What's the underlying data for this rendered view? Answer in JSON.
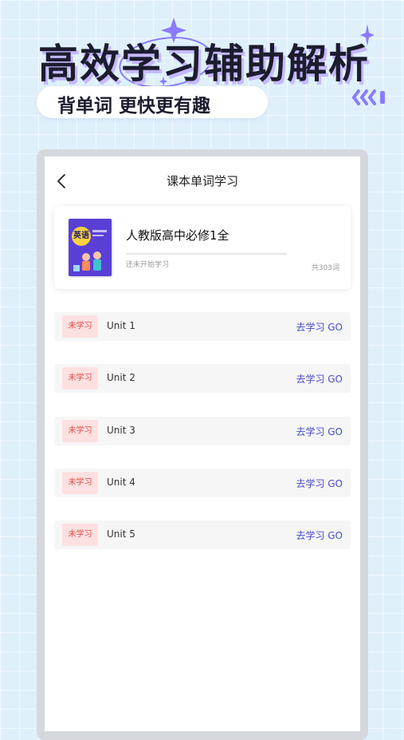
{
  "promo": {
    "headline": "高效学习辅助解析",
    "subtitle": "背单词 更快更有趣",
    "accent_color": "#8a7bff"
  },
  "app": {
    "nav": {
      "title": "课本单词学习",
      "back_icon": "chevron-left-icon"
    },
    "book": {
      "cover_icon": "book-cover-image",
      "cover_badge": "英语",
      "title": "人教版高中必修1全",
      "status": "还未开始学习",
      "word_count": "共303词",
      "progress": 0
    },
    "units": [
      {
        "badge": "未学习",
        "name": "Unit 1",
        "action": "去学习 GO"
      },
      {
        "badge": "未学习",
        "name": "Unit 2",
        "action": "去学习 GO"
      },
      {
        "badge": "未学习",
        "name": "Unit 3",
        "action": "去学习 GO"
      },
      {
        "badge": "未学习",
        "name": "Unit 4",
        "action": "去学习 GO"
      },
      {
        "badge": "未学习",
        "name": "Unit 5",
        "action": "去学习 GO"
      }
    ],
    "colors": {
      "badge_bg": "#fde0e0",
      "badge_text": "#e64a4a",
      "action_text": "#4a4ad0"
    }
  }
}
